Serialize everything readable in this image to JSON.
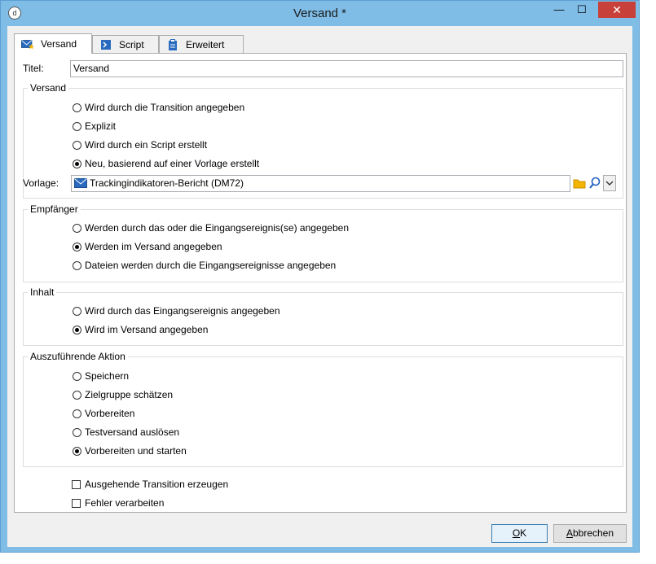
{
  "window": {
    "title": "Versand *"
  },
  "tabs": [
    {
      "label": "Versand",
      "icon": "envelope-star-icon"
    },
    {
      "label": "Script",
      "icon": "script-icon"
    },
    {
      "label": "Erweitert",
      "icon": "clipboard-icon"
    }
  ],
  "title_field": {
    "label": "Titel:",
    "value": "Versand"
  },
  "versand_group": {
    "legend": "Versand",
    "options": [
      "Wird durch die Transition angegeben",
      "Explizit",
      "Wird durch ein Script erstellt",
      "Neu, basierend auf einer Vorlage erstellt"
    ],
    "selected_index": 3,
    "template_label": "Vorlage:",
    "template_value": "Trackingindikatoren-Bericht (DM72)"
  },
  "empfaenger_group": {
    "legend": "Empfänger",
    "options": [
      "Werden durch das oder die Eingangsereignis(se) angegeben",
      "Werden im Versand angegeben",
      "Dateien werden durch die Eingangsereignisse angegeben"
    ],
    "selected_index": 1
  },
  "inhalt_group": {
    "legend": "Inhalt",
    "options": [
      "Wird durch das Eingangsereignis angegeben",
      "Wird im Versand angegeben"
    ],
    "selected_index": 1
  },
  "aktion_group": {
    "legend": "Auszuführende Aktion",
    "options": [
      "Speichern",
      "Zielgruppe schätzen",
      "Vorbereiten",
      "Testversand auslösen",
      "Vorbereiten und starten"
    ],
    "selected_index": 4
  },
  "checkboxes": [
    {
      "label": "Ausgehende Transition erzeugen",
      "checked": false
    },
    {
      "label": "Fehler verarbeiten",
      "checked": false
    }
  ],
  "buttons": {
    "ok_key": "O",
    "ok_rest": "K",
    "cancel_key": "A",
    "cancel_rest": "bbrechen"
  },
  "colors": {
    "titlebar": "#7fbde7",
    "close": "#c7413a",
    "accent": "#3c7fb1"
  }
}
